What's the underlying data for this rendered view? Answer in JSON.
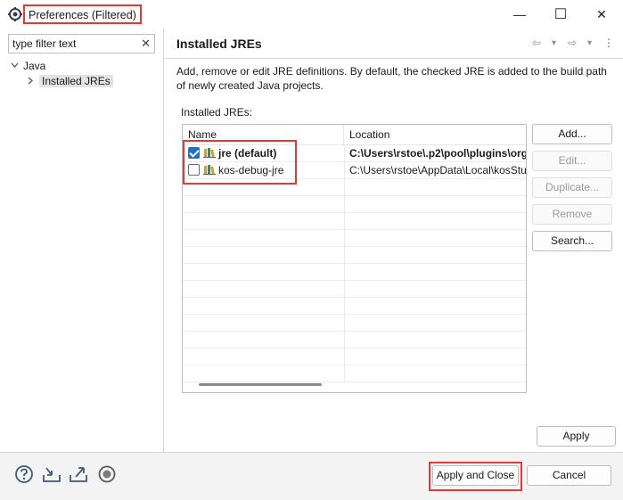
{
  "window": {
    "title": "Preferences (Filtered)",
    "minimize_glyph": "—",
    "maximize_glyph": "☐",
    "close_glyph": "✕"
  },
  "sidebar": {
    "filter_placeholder": "type filter text",
    "filter_value": "type filter text",
    "clear_glyph": "✕",
    "tree": [
      {
        "label": "Java",
        "expanded": true,
        "toggle": "v"
      },
      {
        "label": "Installed JREs",
        "selected": true,
        "toggle": ">"
      }
    ]
  },
  "page": {
    "title": "Installed JREs",
    "description": "Add, remove or edit JRE definitions. By default, the checked JRE is added to the build path of newly created Java projects.",
    "jres_label": "Installed JREs:",
    "nav": {
      "back": "⇦",
      "back_menu": "▾",
      "forward": "⇨",
      "forward_menu": "▾",
      "more": "⋮"
    }
  },
  "table": {
    "columns": [
      "Name",
      "Location"
    ],
    "rows": [
      {
        "name": "jre (default)",
        "location": "C:\\Users\\rstoe\\.p2\\pool\\plugins\\org",
        "checked": true,
        "bold": true
      },
      {
        "name": "kos-debug-jre",
        "location": "C:\\Users\\rstoe\\AppData\\Local\\kosStu",
        "checked": false,
        "bold": false
      }
    ]
  },
  "buttons": {
    "add": "Add...",
    "edit": "Edit...",
    "duplicate": "Duplicate...",
    "remove": "Remove",
    "search": "Search...",
    "apply": "Apply",
    "apply_close": "Apply and Close",
    "cancel": "Cancel"
  },
  "bottom_icons": [
    "help-icon",
    "import-icon",
    "export-icon",
    "record-icon"
  ],
  "colors": {
    "highlight": "#e03a3a",
    "checkbox": "#1f6fd1"
  }
}
